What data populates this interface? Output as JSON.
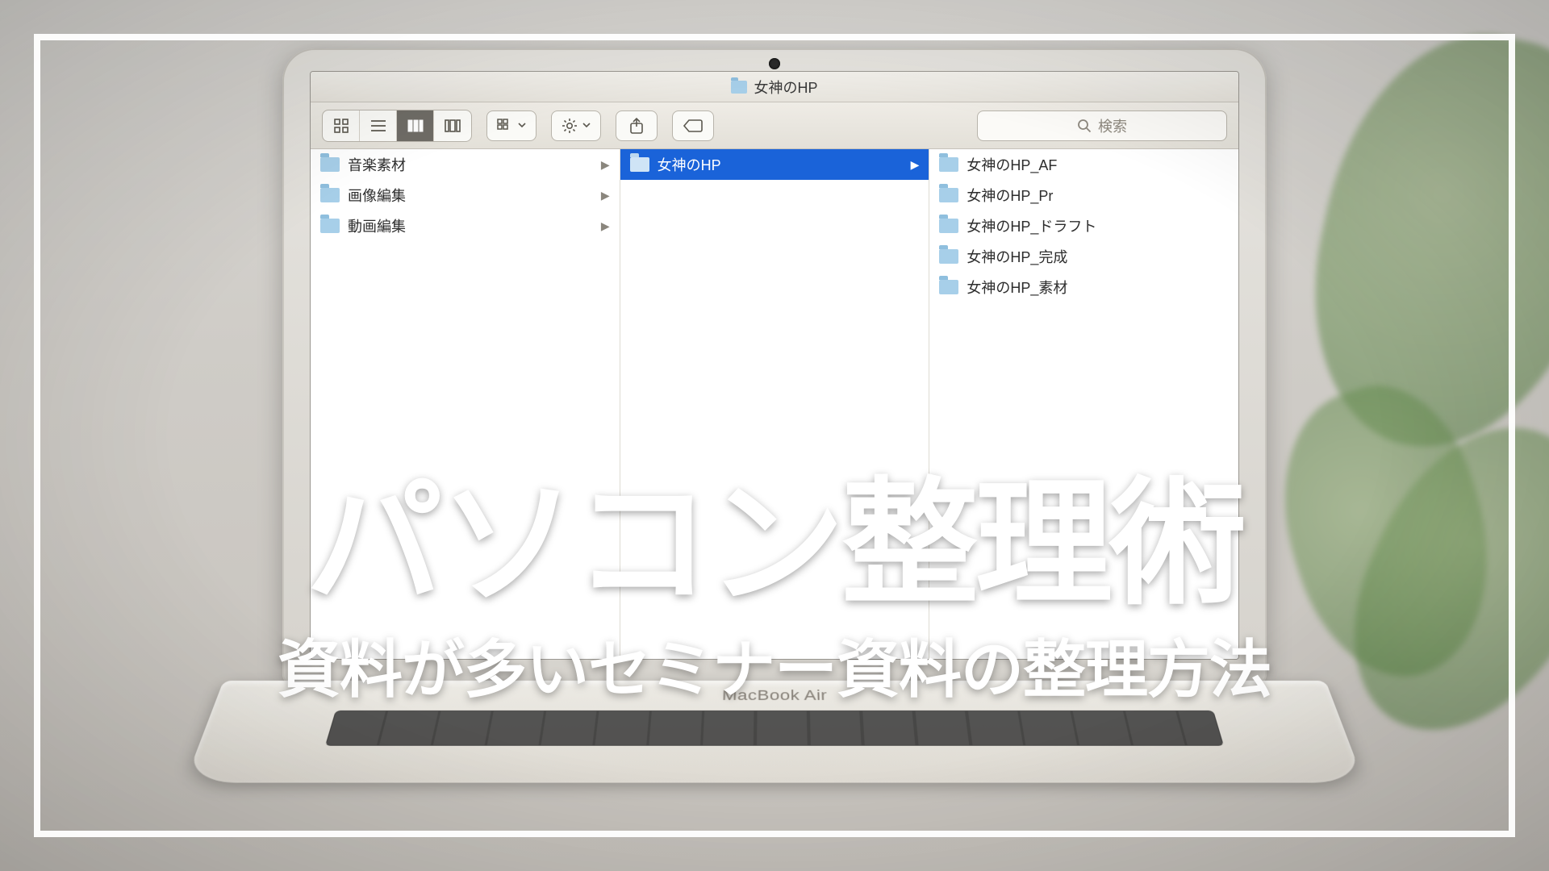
{
  "overlay": {
    "title": "パソコン整理術",
    "subtitle": "資料が多いセミナー資料の整理方法"
  },
  "laptop": {
    "brand": "MacBook Air"
  },
  "finder": {
    "window_title": "女神のHP",
    "search_placeholder": "検索",
    "columns": [
      {
        "items": [
          {
            "label": "音楽素材",
            "has_children": true,
            "selected": false
          },
          {
            "label": "画像編集",
            "has_children": true,
            "selected": false
          },
          {
            "label": "動画編集",
            "has_children": true,
            "selected": false
          }
        ]
      },
      {
        "items": [
          {
            "label": "女神のHP",
            "has_children": true,
            "selected": true
          }
        ]
      },
      {
        "items": [
          {
            "label": "女神のHP_AF",
            "has_children": false,
            "selected": false
          },
          {
            "label": "女神のHP_Pr",
            "has_children": false,
            "selected": false
          },
          {
            "label": "女神のHP_ドラフト",
            "has_children": false,
            "selected": false
          },
          {
            "label": "女神のHP_完成",
            "has_children": false,
            "selected": false
          },
          {
            "label": "女神のHP_素材",
            "has_children": false,
            "selected": false
          }
        ]
      }
    ]
  }
}
